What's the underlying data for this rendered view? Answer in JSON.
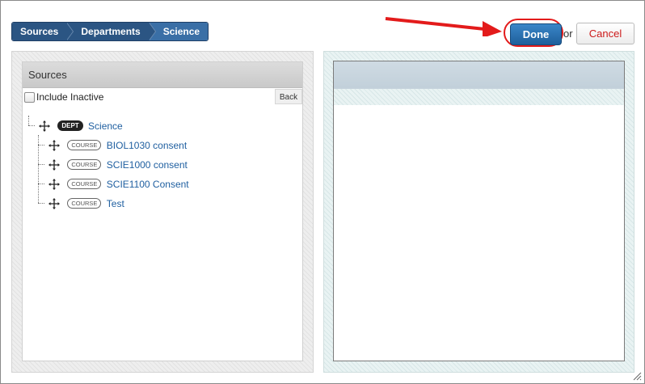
{
  "breadcrumb": [
    "Sources",
    "Departments",
    "Science"
  ],
  "actions": {
    "done_label": "Done",
    "or_label": "or",
    "cancel_label": "Cancel"
  },
  "sources": {
    "header": "Sources",
    "include_inactive_label": "Include Inactive",
    "back_label": "Back",
    "tree": {
      "root": {
        "badge": "DEPT",
        "label": "Science"
      },
      "children": [
        {
          "badge": "COURSE",
          "label": "BIOL1030 consent"
        },
        {
          "badge": "COURSE",
          "label": "SCIE1000 consent"
        },
        {
          "badge": "COURSE",
          "label": "SCIE1100 Consent"
        },
        {
          "badge": "COURSE",
          "label": "Test"
        }
      ]
    }
  },
  "colors": {
    "accent": "#2b5583",
    "done": "#1e5f9b",
    "highlight": "#e31b1b",
    "link": "#1f5fa0"
  },
  "icons": [
    "move-icon",
    "arrow-annotation",
    "resize-grip-icon",
    "checkbox"
  ]
}
